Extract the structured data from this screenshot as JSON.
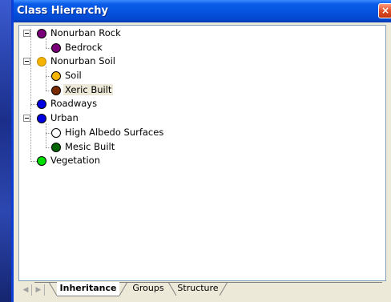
{
  "window": {
    "title": "Class Hierarchy",
    "close_glyph": "×"
  },
  "tree": {
    "nodes": [
      {
        "label": "Nonurban Rock",
        "color": "#7a007a",
        "expanded": true
      },
      {
        "label": "Bedrock",
        "color": "#7a007a"
      },
      {
        "label": "Nonurban Soil",
        "color": "#f4b400",
        "expanded": true
      },
      {
        "label": "Soil",
        "color": "#f4b400"
      },
      {
        "label": "Xeric Built",
        "color": "#7a2a00",
        "selected": true
      },
      {
        "label": "Roadways",
        "color": "#0000e0"
      },
      {
        "label": "Urban",
        "color": "#0000e0",
        "expanded": true
      },
      {
        "label": "High Albedo Surfaces",
        "color": "#ffffff"
      },
      {
        "label": "Mesic Built",
        "color": "#006400"
      },
      {
        "label": "Vegetation",
        "color": "#00e000"
      }
    ]
  },
  "tabs": {
    "items": [
      {
        "label": "Inheritance",
        "active": true
      },
      {
        "label": "Groups",
        "active": false
      },
      {
        "label": "Structure",
        "active": false
      }
    ],
    "nav_prev_icon": "◀",
    "nav_next_icon": "▶"
  }
}
